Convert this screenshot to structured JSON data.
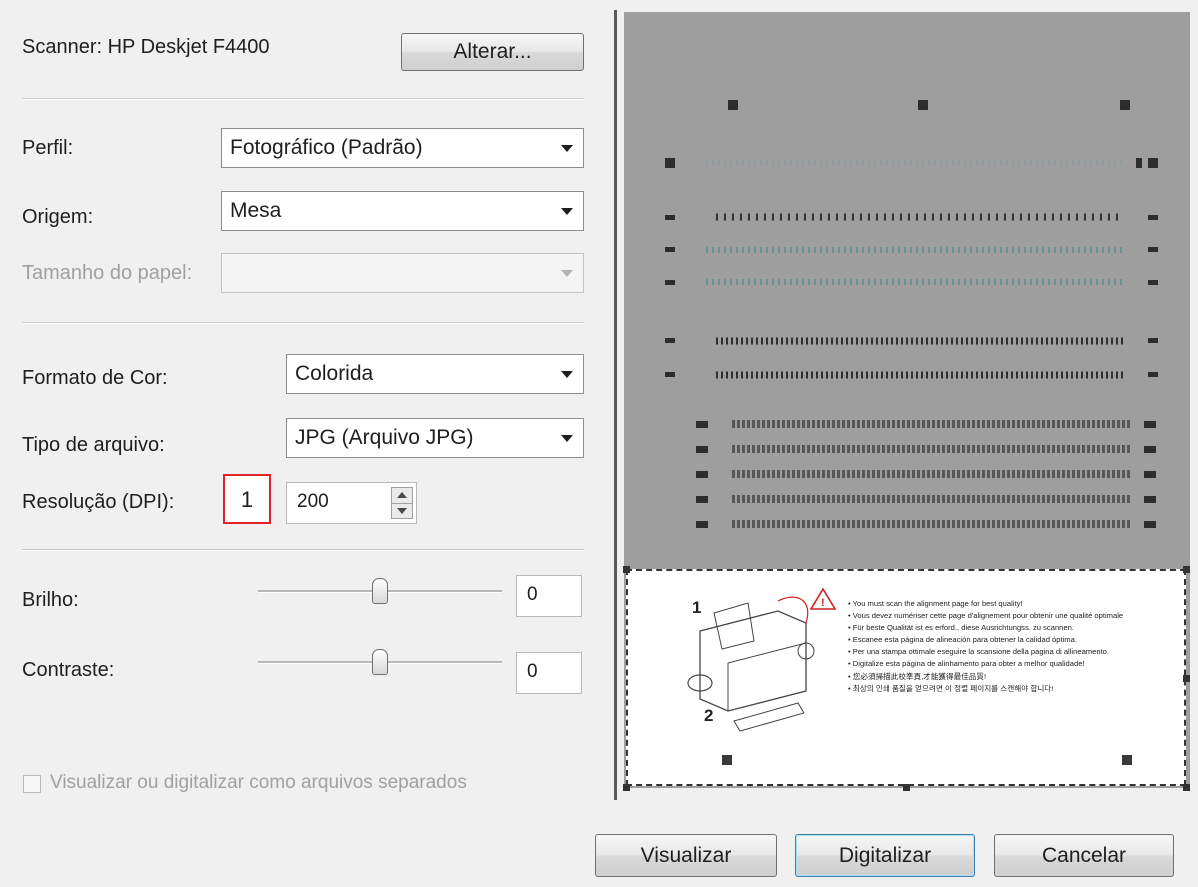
{
  "scanner": {
    "label": "Scanner: HP Deskjet F4400",
    "change_button": "Alterar..."
  },
  "profile": {
    "label": "Perfil:",
    "value": "Fotográfico (Padrão)"
  },
  "source": {
    "label": "Origem:",
    "value": "Mesa"
  },
  "paper_size": {
    "label": "Tamanho do papel:",
    "value": ""
  },
  "color_format": {
    "label": "Formato de Cor:",
    "value": "Colorida"
  },
  "file_type": {
    "label": "Tipo de arquivo:",
    "value": "JPG (Arquivo JPG)"
  },
  "resolution": {
    "label": "Resolução (DPI):",
    "value": "200",
    "marker": "1"
  },
  "brightness": {
    "label": "Brilho:",
    "value": "0",
    "level": 0.5
  },
  "contrast": {
    "label": "Contraste:",
    "value": "0",
    "level": 0.5
  },
  "separate_files": {
    "label": "Visualizar ou digitalizar como arquivos separados",
    "checked": false
  },
  "buttons": {
    "preview": "Visualizar",
    "scan": "Digitalizar",
    "cancel": "Cancelar"
  },
  "preview_page": {
    "step1": "1",
    "step2": "2",
    "notes": [
      "• You must scan the alignment page for best quality!",
      "• Vous devez numériser cette page d'alignement pour obtenir une qualité optimale",
      "• Für beste Qualität ist es erford., diese Ausrichtungss. zu scannen.",
      "• Escanee esta página de alineación para obtener la calidad óptima.",
      "• Per una stampa ottimale eseguire la scansione della pagina di allineamento.",
      "• Digitalize esta página de alinhamento para obter a melhor qualidade!",
      "• 您必須掃描此校準頁,才能獲得最佳品質!",
      "• 최상의 인쇄 품질을 얻으려면 이 정렬 페이지를 스캔해야 합니다!"
    ]
  },
  "colors": {
    "highlight": "#e3212a",
    "scan_bg": "#9e9e9e",
    "default_button": "#3c7fb1"
  }
}
